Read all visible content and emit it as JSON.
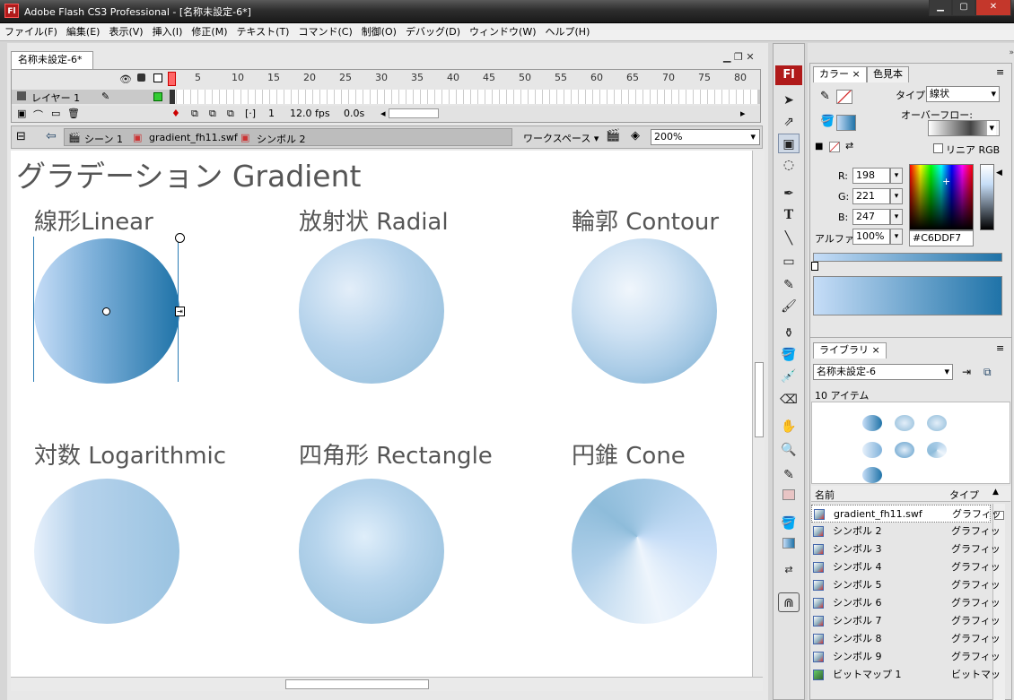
{
  "window": {
    "title": "Adobe Flash CS3 Professional - [名称未設定-6*]",
    "app_icon": "Fl"
  },
  "menu": [
    "ファイル(F)",
    "編集(E)",
    "表示(V)",
    "挿入(I)",
    "修正(M)",
    "テキスト(T)",
    "コマンド(C)",
    "制御(O)",
    "デバッグ(D)",
    "ウィンドウ(W)",
    "ヘルプ(H)"
  ],
  "document": {
    "tab_label": "名称未設定-6*"
  },
  "timeline": {
    "frame_numbers": [
      "1",
      "5",
      "10",
      "15",
      "20",
      "25",
      "30",
      "35",
      "40",
      "45",
      "50",
      "55",
      "60",
      "65",
      "70",
      "75",
      "80"
    ],
    "layer_name": "レイヤー 1",
    "current_frame": "1",
    "fps": "12.0 fps",
    "time": "0.0s"
  },
  "edit_bar": {
    "crumbs": [
      "シーン 1",
      "gradient_fh11.swf",
      "シンボル 2"
    ],
    "workspace": "ワークスペース",
    "zoom": "200%"
  },
  "stage": {
    "title": "グラデーション Gradient",
    "samples": [
      {
        "label": "線形Linear"
      },
      {
        "label": "放射状 Radial"
      },
      {
        "label": "輪郭 Contour"
      },
      {
        "label": "対数 Logarithmic"
      },
      {
        "label": "四角形 Rectangle"
      },
      {
        "label": "円錐 Cone"
      }
    ]
  },
  "color_panel": {
    "tabs": [
      "カラー",
      "色見本"
    ],
    "type_label": "タイプ :",
    "type_value": "線状",
    "overflow_label": "オーバーフロー:",
    "linear_rgb": "リニア RGB",
    "r_label": "R:",
    "r": "198",
    "g_label": "G:",
    "g": "221",
    "b_label": "B:",
    "b": "247",
    "alpha_label": "アルファ:",
    "alpha": "100%",
    "hex": "#C6DDF7"
  },
  "library_panel": {
    "tab": "ライブラリ",
    "document": "名称未設定-6",
    "count": "10 アイテム",
    "col_name": "名前",
    "col_type": "タイプ",
    "items": [
      {
        "name": "gradient_fh11.swf",
        "type": "グラフィッ"
      },
      {
        "name": "シンボル 2",
        "type": "グラフィッ"
      },
      {
        "name": "シンボル 3",
        "type": "グラフィッ"
      },
      {
        "name": "シンボル 4",
        "type": "グラフィッ"
      },
      {
        "name": "シンボル 5",
        "type": "グラフィッ"
      },
      {
        "name": "シンボル 6",
        "type": "グラフィッ"
      },
      {
        "name": "シンボル 7",
        "type": "グラフィッ"
      },
      {
        "name": "シンボル 8",
        "type": "グラフィッ"
      },
      {
        "name": "シンボル 9",
        "type": "グラフィッ"
      },
      {
        "name": "ビットマップ 1",
        "type": "ビットマッ"
      }
    ]
  },
  "colors": {
    "accent": "#c6ddf7",
    "gradient_dark": "#1f73a8",
    "titlebar": "#2e2e2e"
  }
}
